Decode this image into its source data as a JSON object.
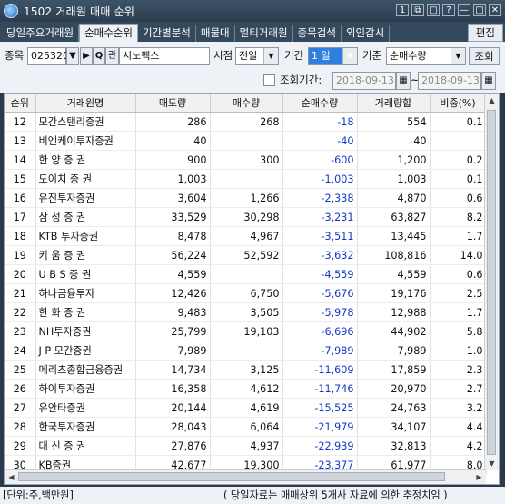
{
  "window": {
    "title": "1502 거래원 매매 순위",
    "controls": [
      "1",
      "⧉",
      "□",
      "?",
      "—",
      "□",
      "✕"
    ]
  },
  "tabs": [
    "당일주요거래원",
    "순매수순위",
    "기간별분석",
    "매물대",
    "멀티거래원",
    "종목검색",
    "외인감시"
  ],
  "active_tab": 1,
  "edit_label": "편집",
  "form": {
    "stock_label": "종목",
    "stock_code": "025320",
    "stock_name": "시노펙스",
    "search_icon_text": "Q",
    "trade_button": "관",
    "time_label": "시점",
    "time_value": "전일",
    "period_label": "기간",
    "period_value": "1 일",
    "criteria_label": "기준",
    "criteria_value": "순매수량",
    "query_button": "조회",
    "query_period_label": "조회기간:",
    "date_from": "2018-09-13",
    "date_to": "2018-09-13",
    "tilde": "~"
  },
  "table": {
    "headers": [
      "순위",
      "거래원명",
      "매도량",
      "매수량",
      "순매수량",
      "거래량합",
      "비중(%)"
    ],
    "rows": [
      [
        "12",
        "모간스탠리증권",
        "286",
        "268",
        "-18",
        "554",
        "0.1"
      ],
      [
        "13",
        "비엔케이투자증권",
        "40",
        "",
        "-40",
        "40",
        ""
      ],
      [
        "14",
        "한 양 증 권",
        "900",
        "300",
        "-600",
        "1,200",
        "0.2"
      ],
      [
        "15",
        "도이치 증 권",
        "1,003",
        "",
        "-1,003",
        "1,003",
        "0.1"
      ],
      [
        "16",
        "유진투자증권",
        "3,604",
        "1,266",
        "-2,338",
        "4,870",
        "0.6"
      ],
      [
        "17",
        "삼 성 증 권",
        "33,529",
        "30,298",
        "-3,231",
        "63,827",
        "8.2"
      ],
      [
        "18",
        "KTB 투자증권",
        "8,478",
        "4,967",
        "-3,511",
        "13,445",
        "1.7"
      ],
      [
        "19",
        "키 움 증 권",
        "56,224",
        "52,592",
        "-3,632",
        "108,816",
        "14.0"
      ],
      [
        "20",
        "U B S 증 권",
        "4,559",
        "",
        "-4,559",
        "4,559",
        "0.6"
      ],
      [
        "21",
        "하나금융투자",
        "12,426",
        "6,750",
        "-5,676",
        "19,176",
        "2.5"
      ],
      [
        "22",
        "한 화 증 권",
        "9,483",
        "3,505",
        "-5,978",
        "12,988",
        "1.7"
      ],
      [
        "23",
        "NH투자증권",
        "25,799",
        "19,103",
        "-6,696",
        "44,902",
        "5.8"
      ],
      [
        "24",
        "J P 모간증권",
        "7,989",
        "",
        "-7,989",
        "7,989",
        "1.0"
      ],
      [
        "25",
        "메리츠종합금융증권",
        "14,734",
        "3,125",
        "-11,609",
        "17,859",
        "2.3"
      ],
      [
        "26",
        "하이투자증권",
        "16,358",
        "4,612",
        "-11,746",
        "20,970",
        "2.7"
      ],
      [
        "27",
        "유안타증권",
        "20,144",
        "4,619",
        "-15,525",
        "24,763",
        "3.2"
      ],
      [
        "28",
        "한국투자증권",
        "28,043",
        "6,064",
        "-21,979",
        "34,107",
        "4.4"
      ],
      [
        "29",
        "대 신 증 권",
        "27,876",
        "4,937",
        "-22,939",
        "32,813",
        "4.2"
      ],
      [
        "30",
        "KB증권",
        "42,677",
        "19,300",
        "-23,377",
        "61,977",
        "8.0"
      ]
    ]
  },
  "status": {
    "unit": "[단위:주,백만원]",
    "note": "( 당일자료는 매매상위 5개사 자료에 의한 추정치임 )"
  },
  "colors": {
    "negative": "#1239c8",
    "titlebar": "#2c3d4e",
    "selected_period": "#2f7fe0"
  }
}
